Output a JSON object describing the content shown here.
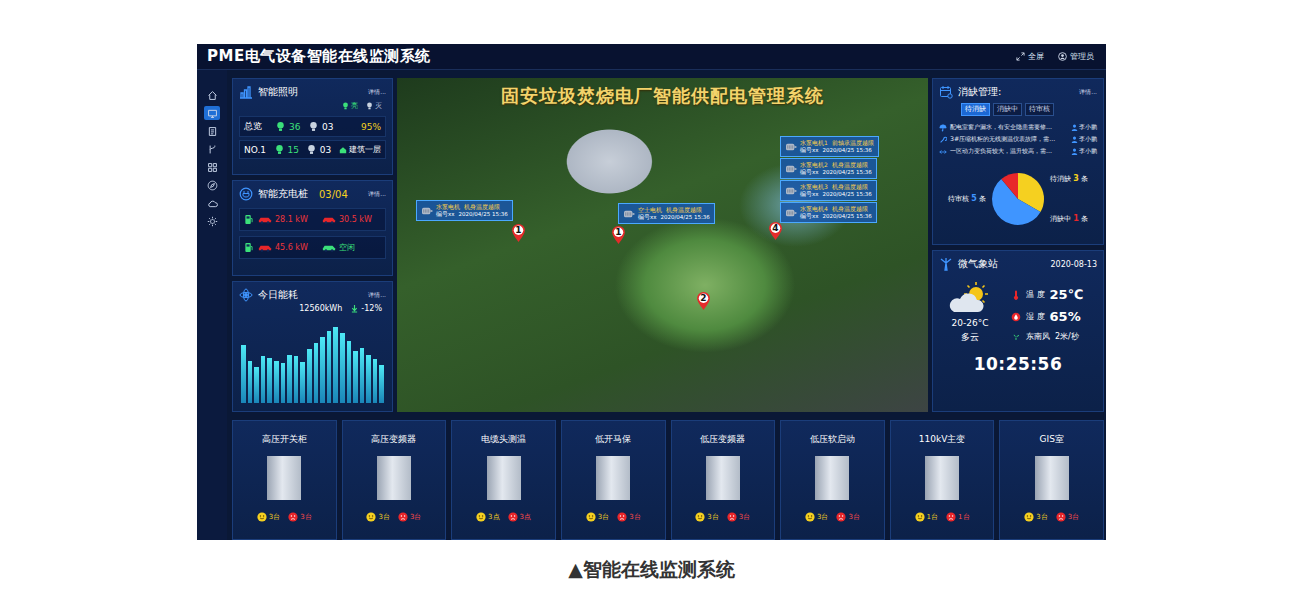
{
  "header": {
    "title": "PME电气设备智能在线监测系统",
    "actions": [
      {
        "label": "全屏"
      },
      {
        "label": "管理员"
      }
    ]
  },
  "sidebar": {
    "items": [
      {
        "selected": false
      },
      {
        "selected": true
      },
      {
        "selected": false
      },
      {
        "selected": false
      },
      {
        "selected": false
      },
      {
        "selected": false
      },
      {
        "selected": false
      },
      {
        "selected": false
      }
    ]
  },
  "lighting": {
    "title": "智能照明",
    "more": "详情...",
    "legend": [
      {
        "label": "亮",
        "color": "#3be07a"
      },
      {
        "label": "灭",
        "color": "#c9d3e0"
      }
    ],
    "rows": [
      {
        "name": "总览",
        "on": "36",
        "off": "03",
        "extra": "95%",
        "kind": "percent"
      },
      {
        "name": "NO.1",
        "on": "15",
        "off": "03",
        "extra": "建筑一层",
        "kind": "location"
      }
    ]
  },
  "charging": {
    "title": "智能充电桩",
    "count": "03/04",
    "more": "详情...",
    "rows": [
      {
        "piles": [
          {
            "reading": "28.1 kW",
            "busy": true
          },
          {
            "reading": "30.5 kW",
            "busy": true
          }
        ]
      },
      {
        "piles": [
          {
            "reading": "45.6 kW",
            "busy": true
          },
          {
            "reading": "空闲",
            "busy": false
          }
        ]
      }
    ]
  },
  "energy": {
    "title": "今日能耗",
    "more": "详情...",
    "total": "12560kWh",
    "change": "-12%",
    "values": [
      58,
      42,
      36,
      47,
      45,
      42,
      40,
      48,
      47,
      41,
      54,
      60,
      66,
      72,
      76,
      70,
      62,
      52,
      55,
      48,
      44,
      38
    ]
  },
  "map": {
    "title": "固安垃圾焚烧电厂智能供配电管理系统",
    "pins": [
      {
        "label": "1"
      },
      {
        "label": "1"
      },
      {
        "label": "2"
      },
      {
        "label": "4"
      }
    ],
    "alerts": [
      {
        "device": "水泵电机",
        "issue": "机身温度越限",
        "code": "编号xx",
        "time": "2020/04/25 15:36"
      },
      {
        "device": "空士电机",
        "issue": "机身温度越限",
        "code": "编号xx",
        "time": "2020/04/25 15:36"
      },
      {
        "device": "水泵电机1",
        "issue": "前轴承温度越限",
        "code": "编号xx",
        "time": "2020/04/25 15:36"
      },
      {
        "device": "水泵电机2",
        "issue": "机身温度越限",
        "code": "编号xx",
        "time": "2020/04/25 15:36"
      },
      {
        "device": "水泵电机3",
        "issue": "机身温度越限",
        "code": "编号xx",
        "time": "2020/04/25 15:36"
      },
      {
        "device": "水泵电机4",
        "issue": "机身温度越限",
        "code": "编号xx",
        "time": "2020/04/25 15:36"
      }
    ]
  },
  "defects": {
    "title": "消缺管理:",
    "more": "详情...",
    "tabs": [
      {
        "label": "待消缺",
        "selected": true
      },
      {
        "label": "消缺中",
        "selected": false
      },
      {
        "label": "待审核",
        "selected": false
      }
    ],
    "items": [
      {
        "text": "配电室窗户漏水，有安全隐患需要修...",
        "user": "李小鹏"
      },
      {
        "text": "3#压缩机柜的无线测温仪表故障，需...",
        "user": "李小鹏"
      },
      {
        "text": "一区动力变负荷较大，温升较高，需...",
        "user": "李小鹏"
      }
    ],
    "summary": [
      {
        "label": "待消缺",
        "count": "3",
        "unit": "条",
        "value": 3,
        "color": "#f5d020"
      },
      {
        "label": "待审核",
        "count": "5",
        "unit": "条",
        "value": 5,
        "color": "#3f95ff"
      },
      {
        "label": "消缺中",
        "count": "1",
        "unit": "条",
        "value": 1,
        "color": "#e8262a"
      }
    ]
  },
  "weather": {
    "title": "微气象站",
    "date": "2020-08-13",
    "range": "20-26°C",
    "condition": "多云",
    "readings": [
      {
        "label": "温 度",
        "value": "25℃",
        "kind": "big"
      },
      {
        "label": "湿 度",
        "value": "65%",
        "kind": "big"
      },
      {
        "label": "东南风",
        "value": "2米/秒",
        "kind": "small"
      }
    ],
    "clock": "10:25:56"
  },
  "devices": [
    {
      "name": "高压开关柜",
      "normal": "3台",
      "alarm": "3台"
    },
    {
      "name": "高压变频器",
      "normal": "3台",
      "alarm": "3台"
    },
    {
      "name": "电缆头测温",
      "normal": "3点",
      "alarm": "3点"
    },
    {
      "name": "低开马保",
      "normal": "3台",
      "alarm": "3台"
    },
    {
      "name": "低压变频器",
      "normal": "3台",
      "alarm": "3台"
    },
    {
      "name": "低压软启动",
      "normal": "3台",
      "alarm": "3台"
    },
    {
      "name": "110kV主变",
      "normal": "1台",
      "alarm": "1台"
    },
    {
      "name": "GIS室",
      "normal": "3台",
      "alarm": "3台"
    }
  ],
  "caption": "▲智能在线监测系统"
}
